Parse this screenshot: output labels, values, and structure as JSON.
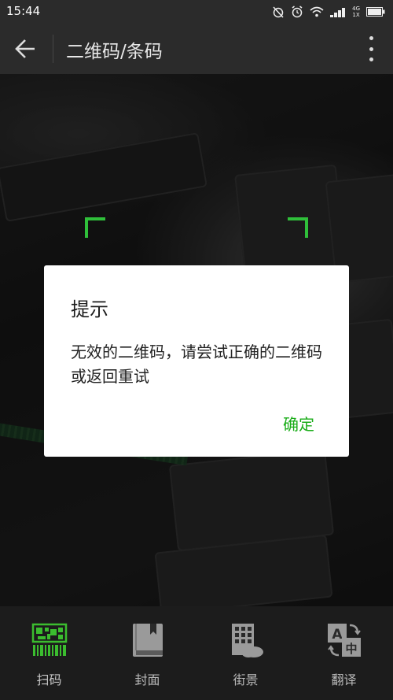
{
  "status_bar": {
    "time": "15:44",
    "network_top": "4G",
    "network_bottom": "1X",
    "icons": [
      "alarm-off-icon",
      "alarm-icon",
      "wifi-icon",
      "signal-icon",
      "battery-icon"
    ]
  },
  "app_bar": {
    "title": "二维码/条码",
    "back_icon": "arrow-left-icon",
    "more_icon": "more-vertical-icon"
  },
  "dialog": {
    "title": "提示",
    "message": "无效的二维码，请尝试正确的二维码或返回重试",
    "confirm_label": "确定",
    "confirm_color": "#1aad19"
  },
  "tabs": [
    {
      "label": "扫码",
      "icon": "qr-barcode-icon",
      "active": true,
      "color": "#3bbd2f"
    },
    {
      "label": "封面",
      "icon": "book-icon",
      "active": false
    },
    {
      "label": "街景",
      "icon": "street-view-icon",
      "active": false
    },
    {
      "label": "翻译",
      "icon": "translate-icon",
      "active": false
    }
  ]
}
